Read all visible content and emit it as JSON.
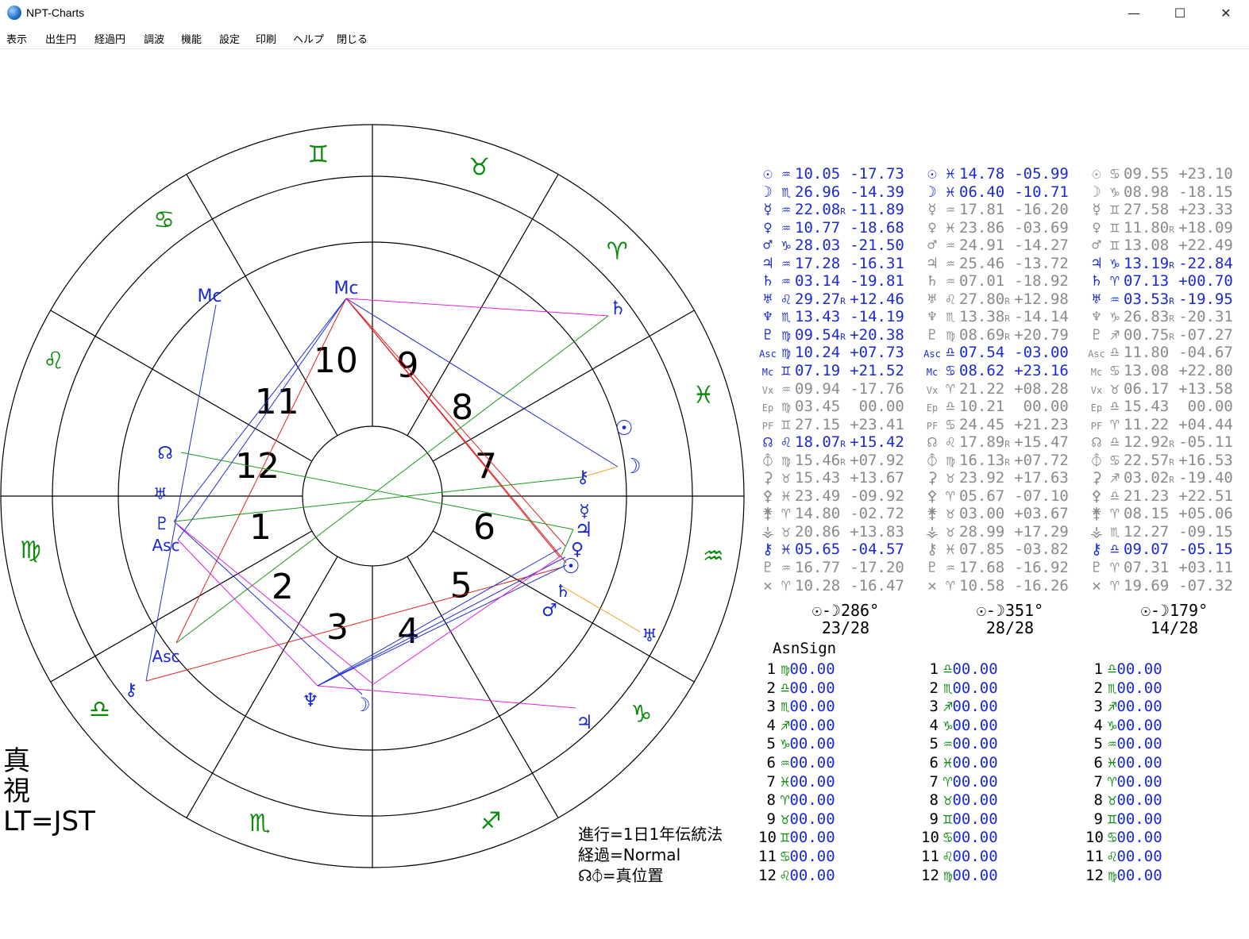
{
  "window": {
    "title": "NPT-Charts",
    "minimize": "—",
    "maximize": "☐",
    "close": "✕"
  },
  "menu": [
    "表示",
    "出生円",
    "経過円",
    "調波",
    "機能",
    "設定",
    "印刷",
    "ヘルプ",
    "閉じる"
  ],
  "wheel": {
    "houses": [
      "1",
      "2",
      "3",
      "4",
      "5",
      "6",
      "7",
      "8",
      "9",
      "10",
      "11",
      "12"
    ],
    "outer_zodiac": [
      {
        "glyph": "♉︎",
        "color": "#0a8a0a"
      },
      {
        "glyph": "♊︎",
        "color": "#0a8a0a"
      },
      {
        "glyph": "♋︎",
        "color": "#0a8a0a"
      },
      {
        "glyph": "♌︎",
        "color": "#0a8a0a"
      },
      {
        "glyph": "♍︎",
        "color": "#0a8a0a"
      },
      {
        "glyph": "♎︎",
        "color": "#0a8a0a"
      },
      {
        "glyph": "♏︎",
        "color": "#0a8a0a"
      },
      {
        "glyph": "♐︎",
        "color": "#0a8a0a"
      },
      {
        "glyph": "♑︎",
        "color": "#0a8a0a"
      },
      {
        "glyph": "♒︎",
        "color": "#0a8a0a"
      },
      {
        "glyph": "♓︎",
        "color": "#0a8a0a"
      },
      {
        "glyph": "♈︎",
        "color": "#0a8a0a"
      }
    ],
    "planet_markers": [
      {
        "glyph": "Mc"
      },
      {
        "glyph": "Mc"
      },
      {
        "glyph": "♄"
      },
      {
        "glyph": "☉"
      },
      {
        "glyph": "☽"
      },
      {
        "glyph": "⚷"
      },
      {
        "glyph": "☿"
      },
      {
        "glyph": "♃"
      },
      {
        "glyph": "♀"
      },
      {
        "glyph": "☉"
      },
      {
        "glyph": "♄"
      },
      {
        "glyph": "♂"
      },
      {
        "glyph": "♅"
      },
      {
        "glyph": "♃"
      },
      {
        "glyph": "☽"
      },
      {
        "glyph": "♆"
      },
      {
        "glyph": "⚷"
      },
      {
        "glyph": "Asc"
      },
      {
        "glyph": "Asc"
      },
      {
        "glyph": "♇"
      },
      {
        "glyph": "♅"
      },
      {
        "glyph": "☊"
      }
    ],
    "aspect_colors": {
      "red": "#e02020",
      "blue": "#2030d0",
      "green": "#1a9a1a",
      "magenta": "#e020e0",
      "orange": "#f0a020"
    }
  },
  "planet_table": [
    {
      "color": "#1a2ad0",
      "rows": [
        {
          "g": "☉",
          "z": "♒︎",
          "v": "10.05",
          "r": "",
          "d": "-17.73",
          "c": "#1a2ad0"
        },
        {
          "g": "☽",
          "z": "♏︎",
          "v": "26.96",
          "r": "",
          "d": "-14.39",
          "c": "#1a2ad0"
        },
        {
          "g": "☿",
          "z": "♒︎",
          "v": "22.08",
          "r": "R",
          "d": "-11.89",
          "c": "#1a2ad0"
        },
        {
          "g": "♀",
          "z": "♒︎",
          "v": "10.77",
          "r": "",
          "d": "-18.68",
          "c": "#1a2ad0"
        },
        {
          "g": "♂",
          "z": "♑︎",
          "v": "28.03",
          "r": "",
          "d": "-21.50",
          "c": "#1a2ad0"
        },
        {
          "g": "♃",
          "z": "♒︎",
          "v": "17.28",
          "r": "",
          "d": "-16.31",
          "c": "#1a2ad0"
        },
        {
          "g": "♄",
          "z": "♒︎",
          "v": "03.14",
          "r": "",
          "d": "-19.81",
          "c": "#1a2ad0"
        },
        {
          "g": "♅",
          "z": "♌︎",
          "v": "29.27",
          "r": "R",
          "d": "+12.46",
          "c": "#1a2ad0"
        },
        {
          "g": "♆",
          "z": "♏︎",
          "v": "13.43",
          "r": "",
          "d": "-14.19",
          "c": "#1a2ad0"
        },
        {
          "g": "♇",
          "z": "♍︎",
          "v": "09.54",
          "r": "R",
          "d": "+20.38",
          "c": "#1a2ad0"
        },
        {
          "g": "Asc",
          "z": "♍︎",
          "v": "10.24",
          "r": "",
          "d": "+07.73",
          "c": "#1a2ad0"
        },
        {
          "g": "Mc",
          "z": "♊︎",
          "v": "07.19",
          "r": "",
          "d": "+21.52",
          "c": "#1a2ad0"
        },
        {
          "g": "Vx",
          "z": "♒︎",
          "v": "09.94",
          "r": "",
          "d": "-17.76",
          "c": "#8a8a8a"
        },
        {
          "g": "Ep",
          "z": "♍︎",
          "v": "03.45",
          "r": "",
          "d": " 00.00",
          "c": "#8a8a8a"
        },
        {
          "g": "PF",
          "z": "♊︎",
          "v": "27.15",
          "r": "",
          "d": "+23.41",
          "c": "#8a8a8a"
        },
        {
          "g": "☊",
          "z": "♌︎",
          "v": "18.07",
          "r": "R",
          "d": "+15.42",
          "c": "#1a2ad0"
        },
        {
          "g": "⦽",
          "z": "♍︎",
          "v": "15.46",
          "r": "R",
          "d": "+07.92",
          "c": "#8a8a8a"
        },
        {
          "g": "⚳",
          "z": "♉︎",
          "v": "15.43",
          "r": "",
          "d": "+13.67",
          "c": "#8a8a8a"
        },
        {
          "g": "⚴",
          "z": "♓︎",
          "v": "23.49",
          "r": "",
          "d": "-09.92",
          "c": "#8a8a8a"
        },
        {
          "g": "⚵",
          "z": "♈︎",
          "v": "14.80",
          "r": "",
          "d": "-02.72",
          "c": "#8a8a8a"
        },
        {
          "g": "⚶",
          "z": "♉︎",
          "v": "20.86",
          "r": "",
          "d": "+13.83",
          "c": "#8a8a8a"
        },
        {
          "g": "⚷",
          "z": "♓︎",
          "v": "05.65",
          "r": "",
          "d": "-04.57",
          "c": "#1a2ad0"
        },
        {
          "g": "♇",
          "z": "♒︎",
          "v": "16.77",
          "r": "",
          "d": "-17.20",
          "c": "#8a8a8a"
        },
        {
          "g": "✕",
          "z": "♈︎",
          "v": "10.28",
          "r": "",
          "d": "-16.47",
          "c": "#8a8a8a"
        }
      ]
    },
    {
      "rows": [
        {
          "g": "☉",
          "z": "♓︎",
          "v": "14.78",
          "r": "",
          "d": "-05.99",
          "c": "#1a2ad0"
        },
        {
          "g": "☽",
          "z": "♓︎",
          "v": "06.40",
          "r": "",
          "d": "-10.71",
          "c": "#1a2ad0"
        },
        {
          "g": "☿",
          "z": "♒︎",
          "v": "17.81",
          "r": "",
          "d": "-16.20",
          "c": "#8a8a8a"
        },
        {
          "g": "♀",
          "z": "♓︎",
          "v": "23.86",
          "r": "",
          "d": "-03.69",
          "c": "#8a8a8a"
        },
        {
          "g": "♂",
          "z": "♒︎",
          "v": "24.91",
          "r": "",
          "d": "-14.27",
          "c": "#8a8a8a"
        },
        {
          "g": "♃",
          "z": "♒︎",
          "v": "25.46",
          "r": "",
          "d": "-13.72",
          "c": "#8a8a8a"
        },
        {
          "g": "♄",
          "z": "♒︎",
          "v": "07.01",
          "r": "",
          "d": "-18.92",
          "c": "#8a8a8a"
        },
        {
          "g": "♅",
          "z": "♌︎",
          "v": "27.80",
          "r": "R",
          "d": "+12.98",
          "c": "#8a8a8a"
        },
        {
          "g": "♆",
          "z": "♏︎",
          "v": "13.38",
          "r": "R",
          "d": "-14.14",
          "c": "#8a8a8a"
        },
        {
          "g": "♇",
          "z": "♍︎",
          "v": "08.69",
          "r": "R",
          "d": "+20.79",
          "c": "#8a8a8a"
        },
        {
          "g": "Asc",
          "z": "♎︎",
          "v": "07.54",
          "r": "",
          "d": "-03.00",
          "c": "#1a2ad0"
        },
        {
          "g": "Mc",
          "z": "♋︎",
          "v": "08.62",
          "r": "",
          "d": "+23.16",
          "c": "#1a2ad0"
        },
        {
          "g": "Vx",
          "z": "♈︎",
          "v": "21.22",
          "r": "",
          "d": "+08.28",
          "c": "#8a8a8a"
        },
        {
          "g": "Ep",
          "z": "♎︎",
          "v": "10.21",
          "r": "",
          "d": " 00.00",
          "c": "#8a8a8a"
        },
        {
          "g": "PF",
          "z": "♋︎",
          "v": "24.45",
          "r": "",
          "d": "+21.23",
          "c": "#8a8a8a"
        },
        {
          "g": "☊",
          "z": "♌︎",
          "v": "17.89",
          "r": "R",
          "d": "+15.47",
          "c": "#8a8a8a"
        },
        {
          "g": "⦽",
          "z": "♍︎",
          "v": "16.13",
          "r": "R",
          "d": "+07.72",
          "c": "#8a8a8a"
        },
        {
          "g": "⚳",
          "z": "♉︎",
          "v": "23.92",
          "r": "",
          "d": "+17.63",
          "c": "#8a8a8a"
        },
        {
          "g": "⚴",
          "z": "♈︎",
          "v": "05.67",
          "r": "",
          "d": "-07.10",
          "c": "#8a8a8a"
        },
        {
          "g": "⚵",
          "z": "♉︎",
          "v": "03.00",
          "r": "",
          "d": "+03.67",
          "c": "#8a8a8a"
        },
        {
          "g": "⚶",
          "z": "♉︎",
          "v": "28.99",
          "r": "",
          "d": "+17.29",
          "c": "#8a8a8a"
        },
        {
          "g": "⚷",
          "z": "♓︎",
          "v": "07.85",
          "r": "",
          "d": "-03.82",
          "c": "#8a8a8a"
        },
        {
          "g": "♇",
          "z": "♒︎",
          "v": "17.68",
          "r": "",
          "d": "-16.92",
          "c": "#8a8a8a"
        },
        {
          "g": "✕",
          "z": "♈︎",
          "v": "10.58",
          "r": "",
          "d": "-16.26",
          "c": "#8a8a8a"
        }
      ]
    },
    {
      "rows": [
        {
          "g": "☉",
          "z": "♋︎",
          "v": "09.55",
          "r": "",
          "d": "+23.10",
          "c": "#8a8a8a"
        },
        {
          "g": "☽",
          "z": "♑︎",
          "v": "08.98",
          "r": "",
          "d": "-18.15",
          "c": "#8a8a8a"
        },
        {
          "g": "☿",
          "z": "♊︎",
          "v": "27.58",
          "r": "",
          "d": "+23.33",
          "c": "#8a8a8a"
        },
        {
          "g": "♀",
          "z": "♊︎",
          "v": "11.80",
          "r": "R",
          "d": "+18.09",
          "c": "#8a8a8a"
        },
        {
          "g": "♂",
          "z": "♊︎",
          "v": "13.08",
          "r": "",
          "d": "+22.49",
          "c": "#8a8a8a"
        },
        {
          "g": "♃",
          "z": "♑︎",
          "v": "13.19",
          "r": "R",
          "d": "-22.84",
          "c": "#1a2ad0"
        },
        {
          "g": "♄",
          "z": "♈︎",
          "v": "07.13",
          "r": "",
          "d": "+00.70",
          "c": "#1a2ad0"
        },
        {
          "g": "♅",
          "z": "♒︎",
          "v": "03.53",
          "r": "R",
          "d": "-19.95",
          "c": "#1a2ad0"
        },
        {
          "g": "♆",
          "z": "♑︎",
          "v": "26.83",
          "r": "R",
          "d": "-20.31",
          "c": "#8a8a8a"
        },
        {
          "g": "♇",
          "z": "♐︎",
          "v": "00.75",
          "r": "R",
          "d": "-07.27",
          "c": "#8a8a8a"
        },
        {
          "g": "Asc",
          "z": "♎︎",
          "v": "11.80",
          "r": "",
          "d": "-04.67",
          "c": "#8a8a8a"
        },
        {
          "g": "Mc",
          "z": "♋︎",
          "v": "13.08",
          "r": "",
          "d": "+22.80",
          "c": "#8a8a8a"
        },
        {
          "g": "Vx",
          "z": "♉︎",
          "v": "06.17",
          "r": "",
          "d": "+13.58",
          "c": "#8a8a8a"
        },
        {
          "g": "Ep",
          "z": "♎︎",
          "v": "15.43",
          "r": "",
          "d": " 00.00",
          "c": "#8a8a8a"
        },
        {
          "g": "PF",
          "z": "♈︎",
          "v": "11.22",
          "r": "",
          "d": "+04.44",
          "c": "#8a8a8a"
        },
        {
          "g": "☊",
          "z": "♎︎",
          "v": "12.92",
          "r": "R",
          "d": "-05.11",
          "c": "#8a8a8a"
        },
        {
          "g": "⦽",
          "z": "♋︎",
          "v": "22.57",
          "r": "R",
          "d": "+16.53",
          "c": "#8a8a8a"
        },
        {
          "g": "⚳",
          "z": "♐︎",
          "v": "03.02",
          "r": "R",
          "d": "-19.40",
          "c": "#8a8a8a"
        },
        {
          "g": "⚴",
          "z": "♎︎",
          "v": "21.23",
          "r": "",
          "d": "+22.51",
          "c": "#8a8a8a"
        },
        {
          "g": "⚵",
          "z": "♈︎",
          "v": "08.15",
          "r": "",
          "d": "+05.06",
          "c": "#8a8a8a"
        },
        {
          "g": "⚶",
          "z": "♏︎",
          "v": "12.27",
          "r": "",
          "d": "-09.15",
          "c": "#8a8a8a"
        },
        {
          "g": "⚷",
          "z": "♎︎",
          "v": "09.07",
          "r": "",
          "d": "-05.15",
          "c": "#1a2ad0"
        },
        {
          "g": "♇",
          "z": "♈︎",
          "v": "07.31",
          "r": "",
          "d": "+03.11",
          "c": "#8a8a8a"
        },
        {
          "g": "✕",
          "z": "♈︎",
          "v": "19.69",
          "r": "",
          "d": "-07.32",
          "c": "#8a8a8a"
        }
      ]
    }
  ],
  "elongation": [
    {
      "angle": "☉-☽286°",
      "phase": "23/28"
    },
    {
      "angle": "☉-☽351°",
      "phase": "28/28"
    },
    {
      "angle": "☉-☽179°",
      "phase": "14/28"
    }
  ],
  "asn_title": "AsnSign",
  "house_signs": [
    [
      "♍︎",
      "♎︎",
      "♏︎",
      "♐︎",
      "♑︎",
      "♒︎",
      "♓︎",
      "♈︎",
      "♉︎",
      "♊︎",
      "♋︎",
      "♌︎"
    ],
    [
      "♎︎",
      "♏︎",
      "♐︎",
      "♑︎",
      "♒︎",
      "♓︎",
      "♈︎",
      "♉︎",
      "♊︎",
      "♋︎",
      "♌︎",
      "♍︎"
    ],
    [
      "♎︎",
      "♏︎",
      "♐︎",
      "♑︎",
      "♒︎",
      "♓︎",
      "♈︎",
      "♉︎",
      "♊︎",
      "♋︎",
      "♌︎",
      "♍︎"
    ]
  ],
  "house_degree": "00.00",
  "notes": [
    "進行=1日1年伝統法",
    "経過=Normal",
    "☊⦽=真位置"
  ],
  "corner_label": [
    "真",
    "視",
    "LT=JST"
  ]
}
